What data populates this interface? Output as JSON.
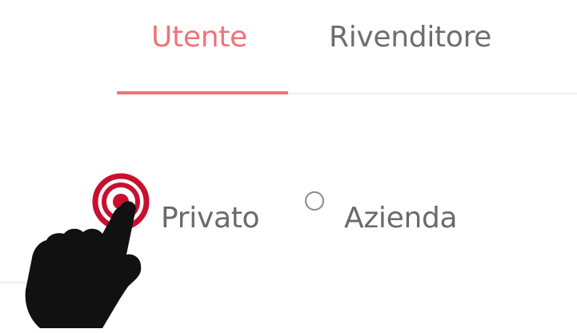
{
  "tabs": [
    {
      "label": "Utente",
      "active": true
    },
    {
      "label": "Rivenditore",
      "active": false
    }
  ],
  "colors": {
    "accent": "#f0737a",
    "tap_indicator": "#c8102e",
    "text": "#6a6a6a",
    "hand": "#111111"
  },
  "customer_type": {
    "options": [
      {
        "label": "Privato",
        "selected": true
      },
      {
        "label": "Azienda",
        "selected": false
      }
    ]
  },
  "overlay": {
    "icon": "tap-hand-icon"
  }
}
